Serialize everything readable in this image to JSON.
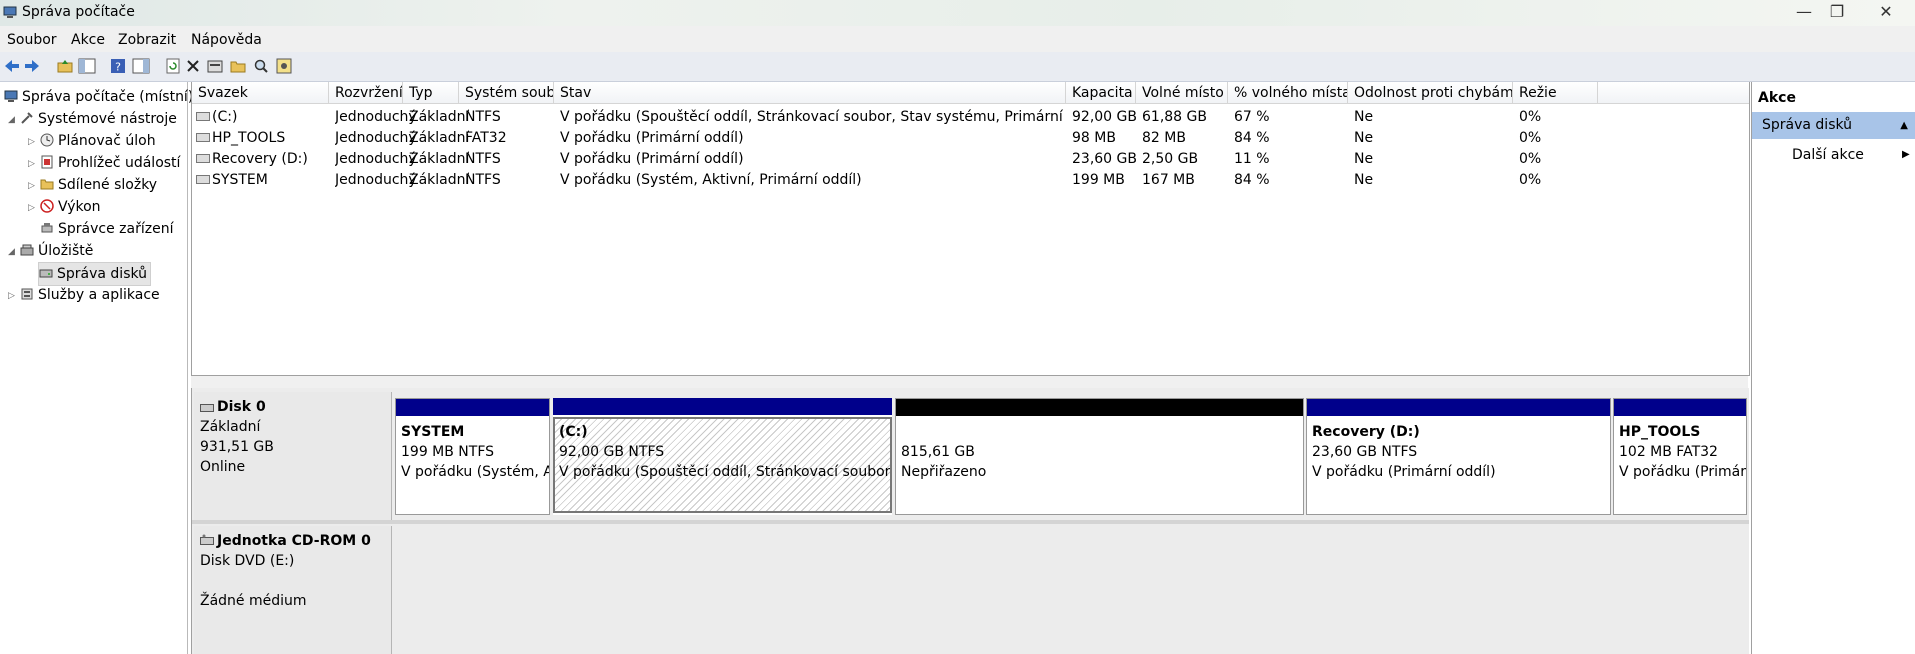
{
  "window": {
    "title": "Správa počítače",
    "controls": {
      "minimize": "—",
      "restore": "❐",
      "close": "✕"
    }
  },
  "menu": [
    "Soubor",
    "Akce",
    "Zobrazit",
    "Nápověda"
  ],
  "toolbar": {
    "icons": [
      "back-arrow-icon",
      "forward-arrow-icon",
      "up-folder-icon",
      "show-hide-tree-icon",
      "help-icon",
      "show-hide-action-pane-icon",
      "refresh-icon",
      "delete-icon",
      "properties-icon",
      "open-icon",
      "search-icon",
      "settings-icon"
    ]
  },
  "tree": {
    "root": "Správa počítače (místní)",
    "system_tools": "Systémové nástroje",
    "task_scheduler": "Plánovač úloh",
    "event_viewer": "Prohlížeč událostí",
    "shared_folders": "Sdílené složky",
    "performance": "Výkon",
    "device_manager": "Správce zařízení",
    "storage": "Úložiště",
    "disk_management": "Správa disků",
    "services": "Služby a aplikace"
  },
  "volume_table": {
    "columns": [
      "Svazek",
      "Rozvržení",
      "Typ",
      "Systém souborů",
      "Stav",
      "Kapacita",
      "Volné místo",
      "% volného místa",
      "Odolnost proti chybám",
      "Režie"
    ],
    "rows": [
      [
        "(C:)",
        "Jednoduchý",
        "Základní",
        "NTFS",
        "V pořádku (Spouštěcí oddíl, Stránkovací soubor, Stav systému, Primární oddíl)",
        "92,00 GB",
        "61,88 GB",
        "67 %",
        "Ne",
        "0%"
      ],
      [
        "HP_TOOLS",
        "Jednoduchý",
        "Základní",
        "FAT32",
        "V pořádku (Primární oddíl)",
        "98 MB",
        "82 MB",
        "84 %",
        "Ne",
        "0%"
      ],
      [
        "Recovery (D:)",
        "Jednoduchý",
        "Základní",
        "NTFS",
        "V pořádku (Primární oddíl)",
        "23,60 GB",
        "2,50 GB",
        "11 %",
        "Ne",
        "0%"
      ],
      [
        "SYSTEM",
        "Jednoduchý",
        "Základní",
        "NTFS",
        "V pořádku (Systém, Aktivní, Primární oddíl)",
        "199 MB",
        "167 MB",
        "84 %",
        "Ne",
        "0%"
      ]
    ]
  },
  "disk0": {
    "name": "Disk 0",
    "type": "Základní",
    "size": "931,51 GB",
    "status": "Online",
    "partitions": [
      {
        "name": "SYSTEM",
        "size": "199 MB NTFS",
        "status": "V pořádku (Systém, A"
      },
      {
        "name": "(C:)",
        "size": "92,00 GB NTFS",
        "status": "V pořádku (Spouštěcí oddíl, Stránkovací soubor, S"
      },
      {
        "name": "",
        "size": "815,61 GB",
        "status": "Nepřiřazeno"
      },
      {
        "name": "Recovery  (D:)",
        "size": "23,60 GB NTFS",
        "status": "V pořádku (Primární oddíl)"
      },
      {
        "name": "HP_TOOLS",
        "size": "102 MB FAT32",
        "status": "V pořádku (Primárr"
      }
    ]
  },
  "cdrom0": {
    "name": "Jednotka CD-ROM 0",
    "type": "Disk DVD (E:)",
    "status": "Žádné médium"
  },
  "actions": {
    "header": "Akce",
    "section": "Správa disků",
    "more": "Další akce",
    "section_arrow": "▲",
    "more_arrow": "▶"
  },
  "colors": {
    "primary_partition_band": "#00008b",
    "unallocated_band": "#000000",
    "selection": "#a8c4e8"
  }
}
